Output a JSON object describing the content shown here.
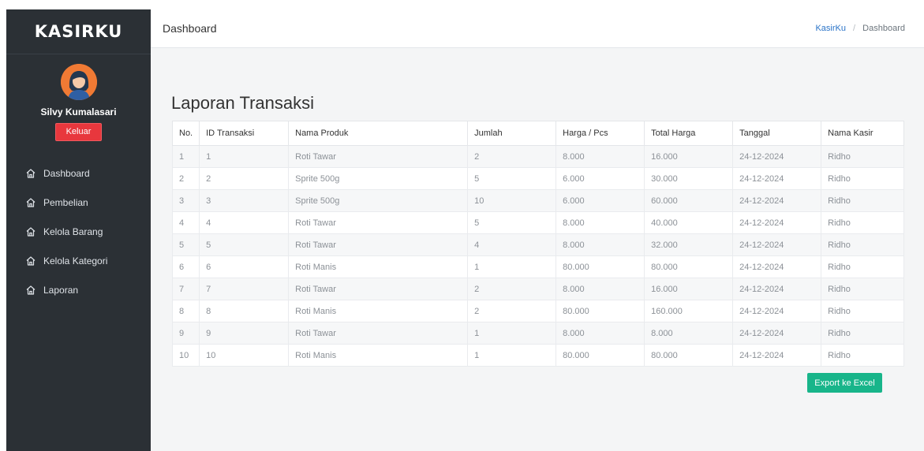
{
  "sidebar": {
    "brand": "KASIRKU",
    "user_name": "Silvy Kumalasari",
    "logout_label": "Keluar",
    "items": [
      {
        "label": "Dashboard",
        "icon": "home-icon"
      },
      {
        "label": "Pembelian",
        "icon": "home-icon"
      },
      {
        "label": "Kelola Barang",
        "icon": "home-icon"
      },
      {
        "label": "Kelola Kategori",
        "icon": "home-icon"
      },
      {
        "label": "Laporan",
        "icon": "home-icon"
      }
    ]
  },
  "header": {
    "title": "Dashboard",
    "breadcrumb": {
      "home": "KasirKu",
      "separator": "/",
      "current": "Dashboard"
    }
  },
  "main": {
    "title": "Laporan Transaksi",
    "export_label": "Export ke Excel",
    "table": {
      "columns": [
        "No.",
        "ID Transaksi",
        "Nama Produk",
        "Jumlah",
        "Harga / Pcs",
        "Total Harga",
        "Tanggal",
        "Nama Kasir"
      ],
      "rows": [
        [
          "1",
          "1",
          "Roti Tawar",
          "2",
          "8.000",
          "16.000",
          "24-12-2024",
          "Ridho"
        ],
        [
          "2",
          "2",
          "Sprite 500g",
          "5",
          "6.000",
          "30.000",
          "24-12-2024",
          "Ridho"
        ],
        [
          "3",
          "3",
          "Sprite 500g",
          "10",
          "6.000",
          "60.000",
          "24-12-2024",
          "Ridho"
        ],
        [
          "4",
          "4",
          "Roti Tawar",
          "5",
          "8.000",
          "40.000",
          "24-12-2024",
          "Ridho"
        ],
        [
          "5",
          "5",
          "Roti Tawar",
          "4",
          "8.000",
          "32.000",
          "24-12-2024",
          "Ridho"
        ],
        [
          "6",
          "6",
          "Roti Manis",
          "1",
          "80.000",
          "80.000",
          "24-12-2024",
          "Ridho"
        ],
        [
          "7",
          "7",
          "Roti Tawar",
          "2",
          "8.000",
          "16.000",
          "24-12-2024",
          "Ridho"
        ],
        [
          "8",
          "8",
          "Roti Manis",
          "2",
          "80.000",
          "160.000",
          "24-12-2024",
          "Ridho"
        ],
        [
          "9",
          "9",
          "Roti Tawar",
          "1",
          "8.000",
          "8.000",
          "24-12-2024",
          "Ridho"
        ],
        [
          "10",
          "10",
          "Roti Manis",
          "1",
          "80.000",
          "80.000",
          "24-12-2024",
          "Ridho"
        ]
      ]
    }
  },
  "colors": {
    "sidebar_bg": "#2b3035",
    "logout_button": "#e8373d",
    "export_button": "#18b58a",
    "breadcrumb_link": "#2b74c8",
    "avatar_bg": "#f07a34"
  }
}
